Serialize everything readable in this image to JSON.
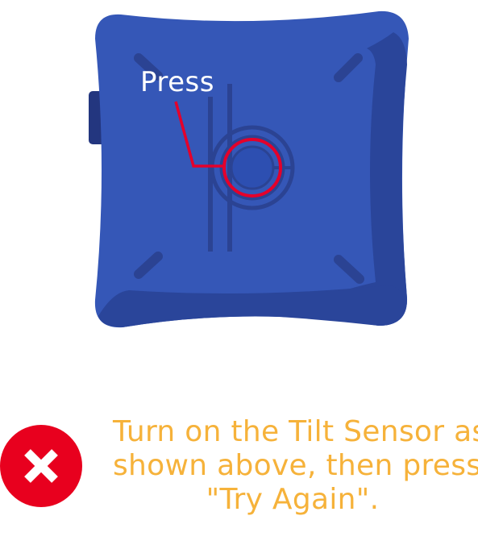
{
  "illustration": {
    "press_label": "Press",
    "colors": {
      "body": "#3557b7",
      "shadow": "#2a459a",
      "dark_edge": "#23367f",
      "grooves": "#2b4393",
      "button": "#2d4fb1",
      "highlight_ring": "#e4002b"
    }
  },
  "message": {
    "lines": [
      "Turn on the Tilt Sensor as",
      "shown above, then press",
      "\"Try Again\"."
    ],
    "color": "#f6b23a"
  },
  "status_icon": {
    "name": "error-x-icon",
    "color": "#e8001e"
  }
}
